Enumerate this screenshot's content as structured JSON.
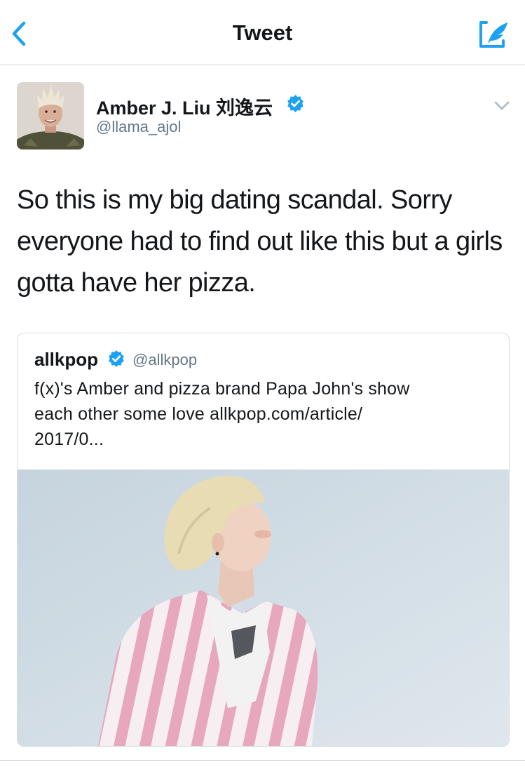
{
  "nav": {
    "title": "Tweet"
  },
  "tweet": {
    "author_name": "Amber J. Liu 刘逸云",
    "author_handle": "@llama_ajol",
    "text": "So this is my big dating scandal. Sorry everyone had to find out like this but a girls gotta have her pizza."
  },
  "quoted": {
    "name": "allkpop",
    "handle": "@allkpop",
    "text_lines": [
      "f(x)'s Amber and pizza brand Papa John's show",
      "each other some love allkpop.com/article/",
      "2017/0..."
    ]
  },
  "icons": {
    "back": "chevron-left-icon",
    "compose": "compose-quill-icon",
    "verified": "verified-badge-icon",
    "caret": "chevron-down-icon"
  },
  "colors": {
    "accent": "#1da1f2",
    "text": "#14171a",
    "secondary": "#657786",
    "border": "#d8dde1"
  }
}
